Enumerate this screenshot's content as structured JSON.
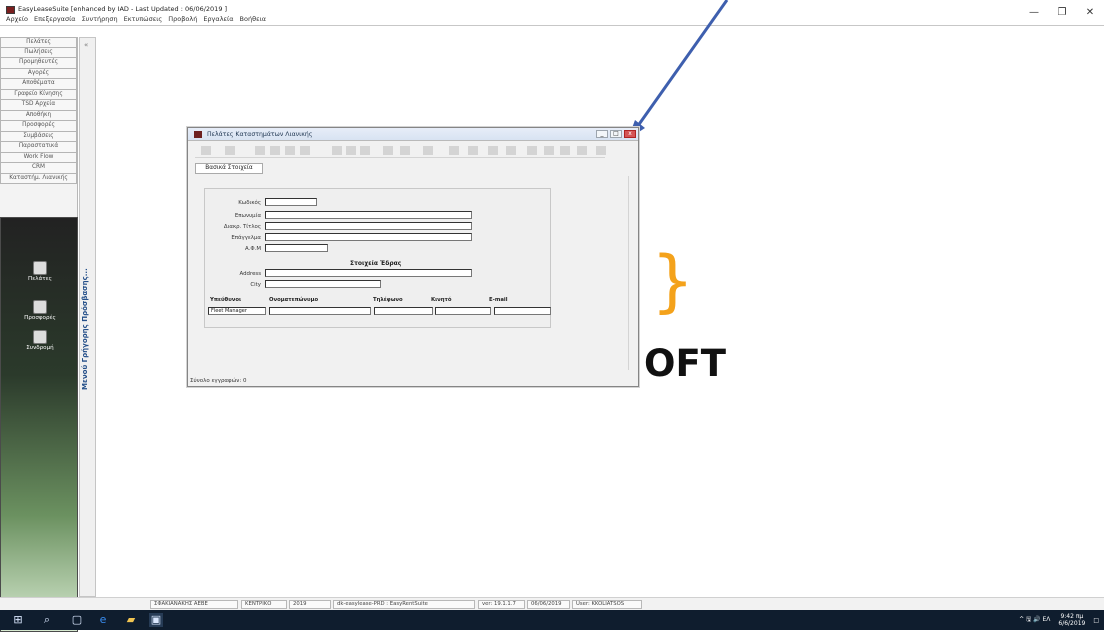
{
  "window": {
    "title": "EasyLeaseSuite [enhanced by IAD - Last Updated : 06/06/2019 ]",
    "minimize": "—",
    "maximize": "❐",
    "close": "✕"
  },
  "menu": [
    "Αρχείο",
    "Επεξεργασία",
    "Συντήρηση",
    "Εκτυπώσεις",
    "Προβολή",
    "Εργαλεία",
    "Βοήθεια"
  ],
  "sidebar": {
    "items": [
      "Πελάτες",
      "Πωλήσεις",
      "Προμηθευτές",
      "Αγορές",
      "Αποθέματα",
      "Γραφείο Κίνησης",
      "TSD Αρχεία",
      "Αποθήκη",
      "Προσφορές",
      "Συμβάσεις",
      "Παραστατικά",
      "Work Flow",
      "CRM",
      "Καταστήμ. Λιανικής"
    ],
    "panel_items": [
      "Πελάτες",
      "Προσφορές",
      "Συνδρομή"
    ],
    "collapse_label": "Μενού Γρήγορης Πρόσβασης...",
    "collapse_arrow": "«"
  },
  "dialog": {
    "title": "Πελάτες Καταστημάτων Λιανικής",
    "tab": "Βασικά Στοιχεία",
    "labels": {
      "code": "Κωδικός",
      "company": "Επωνυμία",
      "trade": "Διακρ. Τίτλος",
      "profession": "Επάγγελμα",
      "vat": "Α.Φ.Μ",
      "section": "Στοιχεία Έδρας",
      "address": "Address",
      "city": "City"
    },
    "table": {
      "headers": [
        "Υπεύθυνοι",
        "Ονοματεπώνυμο",
        "Τηλέφωνο",
        "Κινητό",
        "E-mail"
      ],
      "row": [
        "Fleet Manager",
        "",
        "",
        "",
        ""
      ]
    },
    "status": "Σύνολο εγγραφών: 0"
  },
  "logo": {
    "brace": "}",
    "text": "OFT",
    "accent": "#f4a21b"
  },
  "statusbar": [
    "ΣΦΑΚΙΑΝΑΚΗΣ ΑΕΒΕ",
    "ΚΕΝΤΡΙΚΟ",
    "2019",
    "dk-easylease-PRD : EasyRentSuite",
    "ver: 19.1.1.7",
    "06/06/2019",
    "User: KKOLIATSOS"
  ],
  "taskbar": {
    "tray": "^ 🖫 🔊 ΕΛ",
    "time": "9:42 πμ",
    "date": "6/6/2019"
  }
}
